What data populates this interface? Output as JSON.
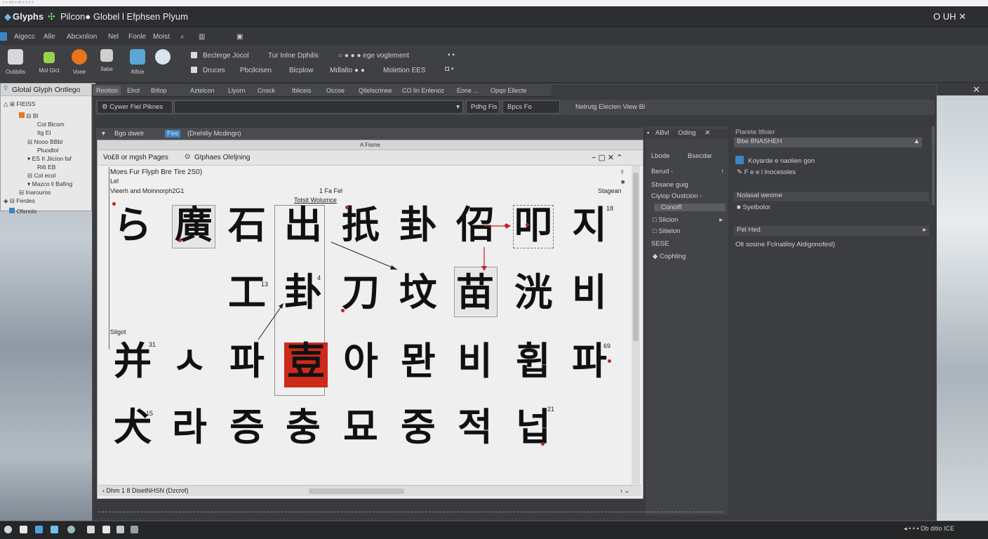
{
  "top_strip": "‹ ‹  ‹‹‹ ‹ ‹‹ ‹  ‹  ‹  ‹",
  "title_bar": {
    "app_name": "Glyphs",
    "doc_title": "Pilcon● Globel l Efphsen Plyum",
    "win_controls": "O  UH  ✕"
  },
  "menu": [
    "Aigecc",
    "Alle",
    "Abcxnlion",
    "Nel",
    "Fonle",
    "Moist"
  ],
  "toolbar": {
    "buttons": [
      {
        "label": "Oolibilis",
        "icon": "user-icon",
        "color": "#d8d8d8"
      },
      {
        "label": "Mol Glct",
        "icon": "glyph-icon",
        "color": "#9bd24b"
      },
      {
        "label": "Voee",
        "icon": "circle-icon",
        "color": "#e8751a"
      },
      {
        "label": "Ilabe",
        "icon": "grid-icon",
        "color": "#cfcfcf"
      },
      {
        "label": "Alfsie",
        "icon": "square-icon",
        "color": "#5aa7d6"
      },
      {
        "label": "",
        "icon": "clock-icon",
        "color": "#d9e4ee"
      }
    ],
    "options_row1": [
      "Beclerge Jocol",
      "Tur Inlne Dphilis",
      "○ ● ● ● ege voglement"
    ],
    "options_row2": [
      "Druces",
      "Pbcilcisen",
      "Blcplow",
      "Mdlalto ● ●",
      "Moletion EES"
    ]
  },
  "left_panel": {
    "title": "Glotal Glyph Ontlego",
    "items": [
      "FIEISS",
      "Bl",
      "Col Blcom",
      "Itg El",
      "Nooo BBbl",
      "Pluodlol",
      "ES II Jiicion faf",
      "Ri6 EB",
      "Col ecol",
      "Mazco li Bafing",
      "Inarouros",
      "Ferdes",
      "Ofsnols"
    ]
  },
  "tabs": [
    "Reotlon",
    "Elrol",
    "Bitlop",
    "Aztelcon",
    "Llyorn",
    "Cnsck",
    "Ibliceis",
    "Occoe",
    "Qtlelscrinee",
    "CO lin Enlenoz",
    "Eone ...",
    "Opqo Ellecte"
  ],
  "search": {
    "label": "Cywer Fiel Piknes",
    "filter1": "Pdhg Fis",
    "filter2": "Bpcs Fo",
    "filter3": "Nelrutg Electen  View  Bl"
  },
  "row_tabs": [
    "Bgo dwelr",
    "Fee",
    "(Drehilly Mcdingn)"
  ],
  "right_panel_header": {
    "label": "ABvl",
    "sub": "Oding"
  },
  "glyph_window": {
    "bar_title": "A Fisme",
    "header_left": "Vo£8 or mgsh Pages",
    "header_mid": "Gtphaes Oleljning",
    "subtitle": "Moes Fur Flyph Bre Tire 2S0)",
    "sub2": "Lel",
    "sub3": "Vieerh and Moinnorph2G1",
    "center_label": "1 Fa Fel",
    "center_label2": "Totsit Wolumce",
    "right_label": "Stagean",
    "side_label": "Sligot",
    "status": "Dhm  1  8  DisetNHSN (Dzcrof)",
    "glyphs_row1": [
      "ら",
      "廣",
      "石",
      "出",
      "扺",
      "卦",
      "佋",
      "叩",
      "지"
    ],
    "glyphs_row2": [
      "工",
      "卦",
      "刀",
      "坟",
      "苗",
      "洸",
      "비"
    ],
    "glyphs_row3": [
      "并",
      "ㅅ",
      "파",
      "壴",
      "아",
      "뫈",
      "비",
      "휩",
      "파"
    ],
    "glyphs_row4": [
      "犬",
      "라",
      "증",
      "충",
      "묘",
      "중",
      "적",
      "넙"
    ],
    "nums": [
      "18",
      "4",
      "31",
      "15",
      "13",
      "21",
      "69"
    ]
  },
  "right_panel": {
    "header1": "Lbode",
    "header2": "Bsecdar",
    "items": [
      "Berud -",
      "Sbsane  guig",
      "Ciyiop  Oustcion  -",
      "Conolfl",
      "Slicion",
      "Sitieion",
      "SESE",
      "Cophling"
    ]
  },
  "far_panel": {
    "title": "Plarete Itfoier",
    "field": "Bbe 8NASHEH",
    "item1": "Koyarde e naolien gon",
    "item2": "F e e l lnocessles",
    "section": "Nolasal weome",
    "item3": "Syelbolor",
    "section2": "Pel Hed",
    "desc": "Olt sosine Fclnatiloy Aldigonofesl)"
  },
  "taskbar": {
    "right": "◂  •  •  ▪  Db  ditio ICE"
  },
  "colors": {
    "accent_red": "#c51f20",
    "highlight": "#cc2a1a"
  }
}
